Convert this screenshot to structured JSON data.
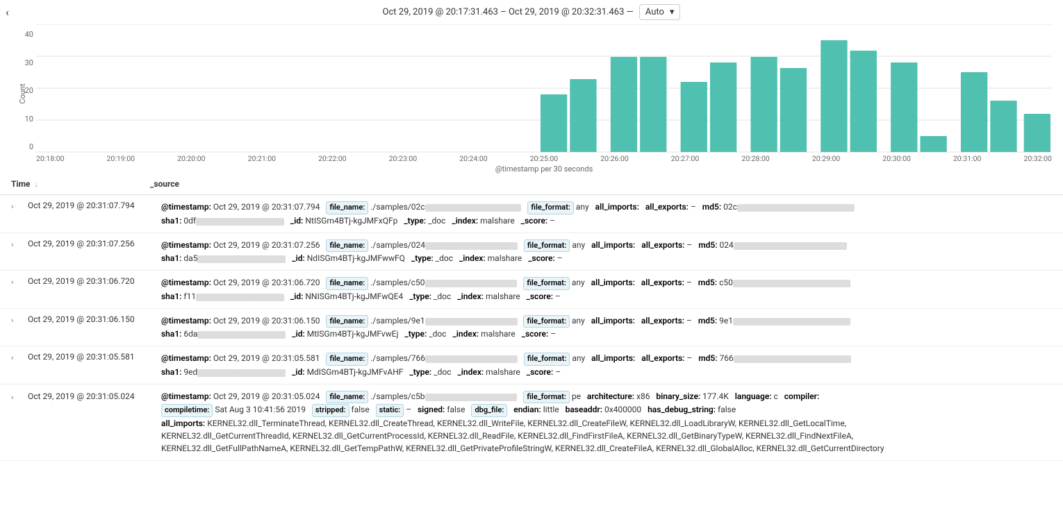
{
  "header": {
    "back_label": "‹",
    "date_range": "Oct 29, 2019 @ 20:17:31.463 – Oct 29, 2019 @ 20:32:31.463  —",
    "auto_label": "Auto",
    "dropdown_icon": "▾"
  },
  "chart": {
    "y_label": "Count",
    "x_label": "@timestamp per 30 seconds",
    "y_ticks": [
      "40",
      "30",
      "20",
      "10",
      "0"
    ],
    "x_ticks": [
      "20:18:00",
      "20:19:00",
      "20:20:00",
      "20:21:00",
      "20:22:00",
      "20:23:00",
      "20:24:00",
      "20:25:00",
      "20:26:00",
      "20:27:00",
      "20:28:00",
      "20:29:00",
      "20:30:00",
      "20:31:00",
      "20:32:00"
    ],
    "bars": [
      {
        "x": "20:18:00",
        "height": 0
      },
      {
        "x": "20:19:00",
        "height": 0
      },
      {
        "x": "20:20:00",
        "height": 0
      },
      {
        "x": "20:21:00",
        "height": 0
      },
      {
        "x": "20:22:00",
        "height": 0
      },
      {
        "x": "20:23:00",
        "height": 0
      },
      {
        "x": "20:24:00",
        "height": 0
      },
      {
        "x": "20:25:00",
        "height": 18
      },
      {
        "x": "20:25:30",
        "height": 23
      },
      {
        "x": "20:26:00",
        "height": 30
      },
      {
        "x": "20:26:30",
        "height": 30
      },
      {
        "x": "20:27:00",
        "height": 22
      },
      {
        "x": "20:27:30",
        "height": 28
      },
      {
        "x": "20:28:00",
        "height": 30
      },
      {
        "x": "20:28:30",
        "height": 27
      },
      {
        "x": "20:29:00",
        "height": 35
      },
      {
        "x": "20:29:30",
        "height": 32
      },
      {
        "x": "20:30:00",
        "height": 28
      },
      {
        "x": "20:30:30",
        "height": 5
      },
      {
        "x": "20:31:00",
        "height": 25
      },
      {
        "x": "20:31:30",
        "height": 16
      },
      {
        "x": "20:32:00",
        "height": 12
      }
    ]
  },
  "table": {
    "col_time": "Time",
    "col_source": "_source",
    "sort_indicator": "↓",
    "rows": [
      {
        "time": "Oct 29, 2019 @ 20:31:07.794",
        "line1": "@timestamp: Oct 29, 2019 @ 20:31:07.794   file_name: ./samples/02c■■■■ ■■■■■■ ■■■■■■ ■■■■■   file_format: any   all_imports:   all_exports: –   md5: 02c■■■■ ■■■■■■ ■■■■■■ ■■■■■■■",
        "line2": "sha1: 0df■■■■ ■■■■■■ ■■■■■■ ■■■■■   _id: NtISGm4BTj-kgJMFxQFp   _type: _doc   _index: malshare   _score: –"
      },
      {
        "time": "Oct 29, 2019 @ 20:31:07.256",
        "line1": "@timestamp: Oct 29, 2019 @ 20:31:07.256   file_name: ./samples/024■■■■ ■■■■■■ ■■■■■■ ■■■■■   file_format: any   all_imports:   all_exports: –   md5: 024■■■■ ■■■■■■ ■■■■■■ ■■■■■■",
        "line2": "sha1: da5■■■■ ■■■■■■ ■■■■■■ ■■■■■   _id: NdISGm4BTj-kgJMFwwFQ   _type: _doc   _index: malshare   _score: –"
      },
      {
        "time": "Oct 29, 2019 @ 20:31:06.720",
        "line1": "@timestamp: Oct 29, 2019 @ 20:31:06.720   file_name: ./samples/c50■■■■ ■■■■■■ ■■■■■■ ■■■■■   file_format: any   all_imports:   all_exports: –   md5: c50■■■■ ■■■■■■ ■■■■■■ ■■■■■■",
        "line2": "sha1: f11■■■■ ■■■■■■ ■■■■■■ ■■■■■   _id: NNISGm4BTj-kgJMFwQE4   _type: _doc   _index: malshare   _score: –"
      },
      {
        "time": "Oct 29, 2019 @ 20:31:06.150",
        "line1": "@timestamp: Oct 29, 2019 @ 20:31:06.150   file_name: ./samples/9e1■■■■ ■■■■■■ ■■■■■■ ■■■■■   file_format: any   all_imports:   all_exports: –   md5: 9e1■■■■ ■■■■■■ ■■■■■■ ■■■■■■",
        "line2": "sha1: 6da■■■■ ■■■■■■ ■■■■■■ ■■■■■   _id: MtISGm4BTj-kgJMFvwEj   _type: _doc   _index: malshare   _score: –"
      },
      {
        "time": "Oct 29, 2019 @ 20:31:05.581",
        "line1": "@timestamp: Oct 29, 2019 @ 20:31:05.581   file_name: ./samples/766■■■■ ■■■■■■ ■■■■■■ ■■■■■   file_format: any   all_imports:   all_exports: –   md5: 766■■■■ ■■■■■■ ■■■■■■ ■■■■■■",
        "line2": "sha1: 9ed■■■■ ■■■■■■ ■■■■■■ ■■■■■   _id: MdISGm4BTj-kgJMFvAHF   _type: _doc   _index: malshare   _score: –"
      },
      {
        "time": "Oct 29, 2019 @ 20:31:05.024",
        "line1": "@timestamp: Oct 29, 2019 @ 20:31:05.024   file_name: ./samples/c5b■■■■ ■■■■■■ ■■■■■■ ■■■■■   file_format: pe   architecture: x86   binary_size: 177.4K   language: c   compiler:",
        "line2": "compiletime: Sat Aug 3 10:41:56 2019   stripped: false   static: –   signed: false   dbg_file:   endian: little   baseaddr: 0x400000   has_debug_string: false",
        "line3": "all_imports: KERNEL32.dll_TerminateThread, KERNEL32.dll_CreateThread, KERNEL32.dll_WriteFile, KERNEL32.dll_CreateFileW, KERNEL32.dll_LoadLibraryW, KERNEL32.dll_GetLocalTime,",
        "line4": "KERNEL32.dll_GetCurrentThreadId, KERNEL32.dll_GetCurrentProcessId, KERNEL32.dll_ReadFile, KERNEL32.dll_FindFirstFileA, KERNEL32.dll_GetBinaryTypeW, KERNEL32.dll_FindNextFileA,",
        "line5": "KERNEL32.dll_GetFullPathNameA, KERNEL32.dll_GetTempPathW, KERNEL32.dll_GetPrivateProfileStringW, KERNEL32.dll_CreateFileA, KERNEL32.dll_GlobalAlloc, KERNEL32.dll_GetCurrentDirectory"
      }
    ]
  }
}
